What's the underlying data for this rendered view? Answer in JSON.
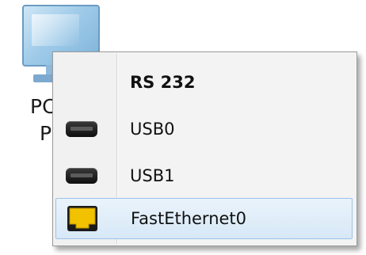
{
  "device": {
    "label_line1": "PC",
    "label_line2": "P"
  },
  "menu": {
    "items": [
      {
        "label": "RS 232",
        "icon": null,
        "highlighted": false,
        "bold": true
      },
      {
        "label": "USB0",
        "icon": "usb-port-icon",
        "highlighted": false,
        "bold": false
      },
      {
        "label": "USB1",
        "icon": "usb-port-icon",
        "highlighted": false,
        "bold": false
      },
      {
        "label": "FastEthernet0",
        "icon": "ethernet-port-icon",
        "highlighted": true,
        "bold": false
      }
    ]
  },
  "colors": {
    "highlight": "#d7e8f7",
    "highlight_border": "#9cc2e8",
    "ethernet_port": "#f2c200",
    "usb_port": "#1a1a1a"
  }
}
